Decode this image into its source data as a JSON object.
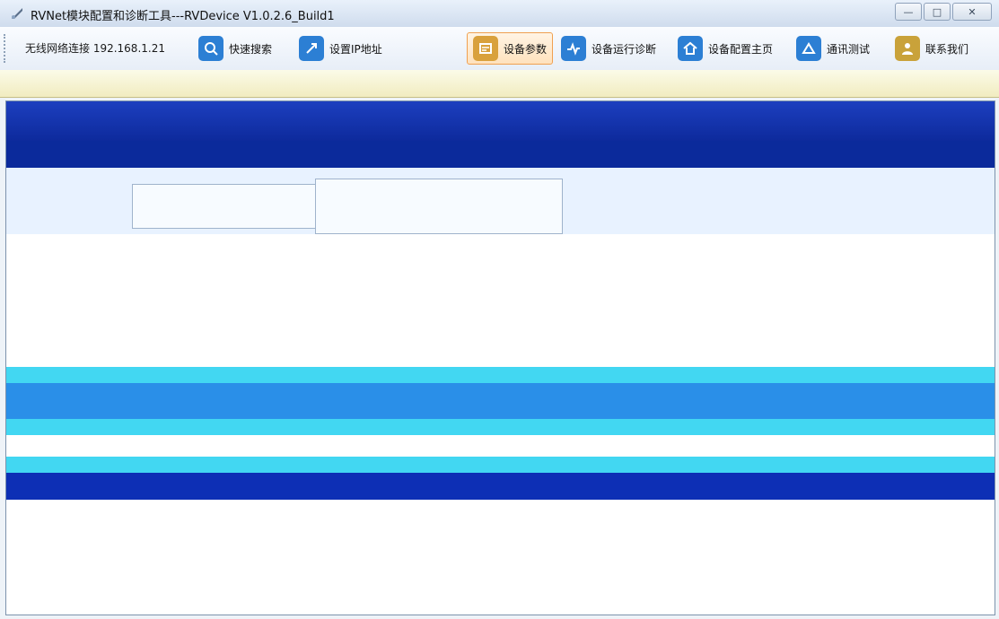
{
  "window": {
    "title": "RVNet模块配置和诊断工具---RVDevice V1.0.2.6_Build1",
    "buttons": [
      "—",
      "□",
      "✕"
    ]
  },
  "toolbar": {
    "status": "无线网络连接 192.168.1.21",
    "items": [
      {
        "label": "快速搜索",
        "icon": "search-icon",
        "color": "#2c7fd4"
      },
      {
        "label": "设置IP地址",
        "icon": "ip-config-icon",
        "color": "#2c7fd4"
      },
      {
        "label": "设备参数",
        "icon": "device-params-icon",
        "color": "#d9a13c"
      },
      {
        "label": "设备运行诊断",
        "icon": "diagnostic-icon",
        "color": "#2c7fd4"
      },
      {
        "label": "设备配置主页",
        "icon": "home-icon",
        "color": "#2c7fd4"
      },
      {
        "label": "通讯测试",
        "icon": "test-icon",
        "color": "#2c7fd4"
      },
      {
        "label": "联系我们",
        "icon": "contact-icon",
        "color": "#c9a23a"
      }
    ],
    "active_index": 2
  },
  "colors": {
    "accent": "#0b2a9b",
    "active_border": "#f0a050",
    "band": "#f1ecc0",
    "cyan": "#42d7f2"
  }
}
